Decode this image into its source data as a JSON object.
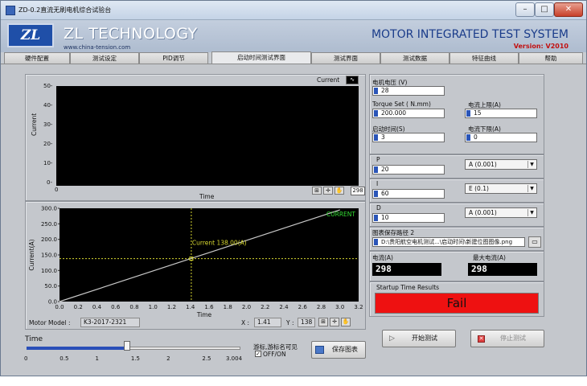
{
  "window": {
    "title": "ZD-0.2直流无刷电机综合试验台"
  },
  "banner": {
    "logo_text": "ZL",
    "company": "ZL TECHNOLOGY",
    "website": "www.china-tension.com",
    "system_title": "MOTOR INTEGRATED TEST SYSTEM",
    "version": "Version: V2010"
  },
  "tabs": [
    {
      "label": "硬件配置"
    },
    {
      "label": "测试设定"
    },
    {
      "label": "PID调节"
    },
    {
      "label": "启动时间测试界面"
    },
    {
      "label": "测试界面"
    },
    {
      "label": "测试数据"
    },
    {
      "label": "特征曲线"
    },
    {
      "label": "帮助"
    }
  ],
  "top_chart": {
    "legend": "Current",
    "ylabel": "Current",
    "xlabel": "Time",
    "x_min_label": "0",
    "x_max_label": "298",
    "yticks": [
      "50-",
      "40-",
      "30-",
      "20-",
      "10-",
      "0-"
    ]
  },
  "chart_data": {
    "type": "line",
    "title": "",
    "xlabel": "Time",
    "ylabel": "Current(A)",
    "xlim": [
      0,
      3.2
    ],
    "ylim": [
      0,
      300
    ],
    "xticks": [
      "0.0",
      "0.2",
      "0.4",
      "0.6",
      "0.8",
      "1.0",
      "1.2",
      "1.4",
      "1.6",
      "1.8",
      "2.0",
      "2.2",
      "2.4",
      "2.6",
      "2.8",
      "3.0",
      "3.2"
    ],
    "yticks": [
      "0.0",
      "50.0",
      "100.0",
      "150.0",
      "200.0",
      "250.0",
      "300.0"
    ],
    "series": [
      {
        "name": "CURRENT",
        "color": "#c8c8c8",
        "x": [
          0.0,
          3.0
        ],
        "y": [
          0.0,
          295.0
        ]
      }
    ],
    "cursor": {
      "label": "Current 138.00(A)",
      "x": 1.41,
      "y": 138.0,
      "color": "#d8d830"
    },
    "grid": false,
    "legend_position": "top-right"
  },
  "bottom_chart": {
    "motor_model_label": "Motor Model :",
    "motor_model_value": "K3-2017-2321",
    "x_label": "X :",
    "x_value": "1.41",
    "y_label": "Y :",
    "y_value": "138"
  },
  "slider": {
    "label": "Time",
    "value": 1.41,
    "max": 3.004,
    "ticks": [
      "0",
      "0.5",
      "1",
      "1.5",
      "2",
      "2.5",
      "3.004"
    ]
  },
  "cursor_toggle": {
    "label": "游标,游标名可见",
    "check_label": "OFF/ON"
  },
  "save_chart_button": "保存图表",
  "params": {
    "motor_voltage_label": "电机电压 (V)",
    "motor_voltage": "28",
    "torque_label": "Torque Set ( N.mm)",
    "torque": "200.000",
    "current_upper_label": "电流上限(A)",
    "current_upper": "15",
    "start_time_label": "启动时间(S)",
    "start_time": "3",
    "current_lower_label": "电流下限(A)",
    "current_lower": "0"
  },
  "pid": {
    "p_label": "P",
    "p_value": "20",
    "p_unit": "A (0.001)",
    "i_label": "I",
    "i_value": "60",
    "i_unit": "E (0.1)",
    "d_label": "D",
    "d_value": "10",
    "d_unit": "A (0.001)"
  },
  "image_save": {
    "label": "图表保存路径 2",
    "path": "D:\\贵阳航空电机测试...\\启动时间\\新建位图图像.png"
  },
  "readouts": {
    "current_label": "电流(A)",
    "current": "298",
    "max_current_label": "最大电流(A)",
    "max_current": "298"
  },
  "result": {
    "label": "Startup Time Results",
    "value": "Fail",
    "color": "#ee1111"
  },
  "buttons": {
    "start": "开始测试",
    "stop": "停止测试"
  }
}
